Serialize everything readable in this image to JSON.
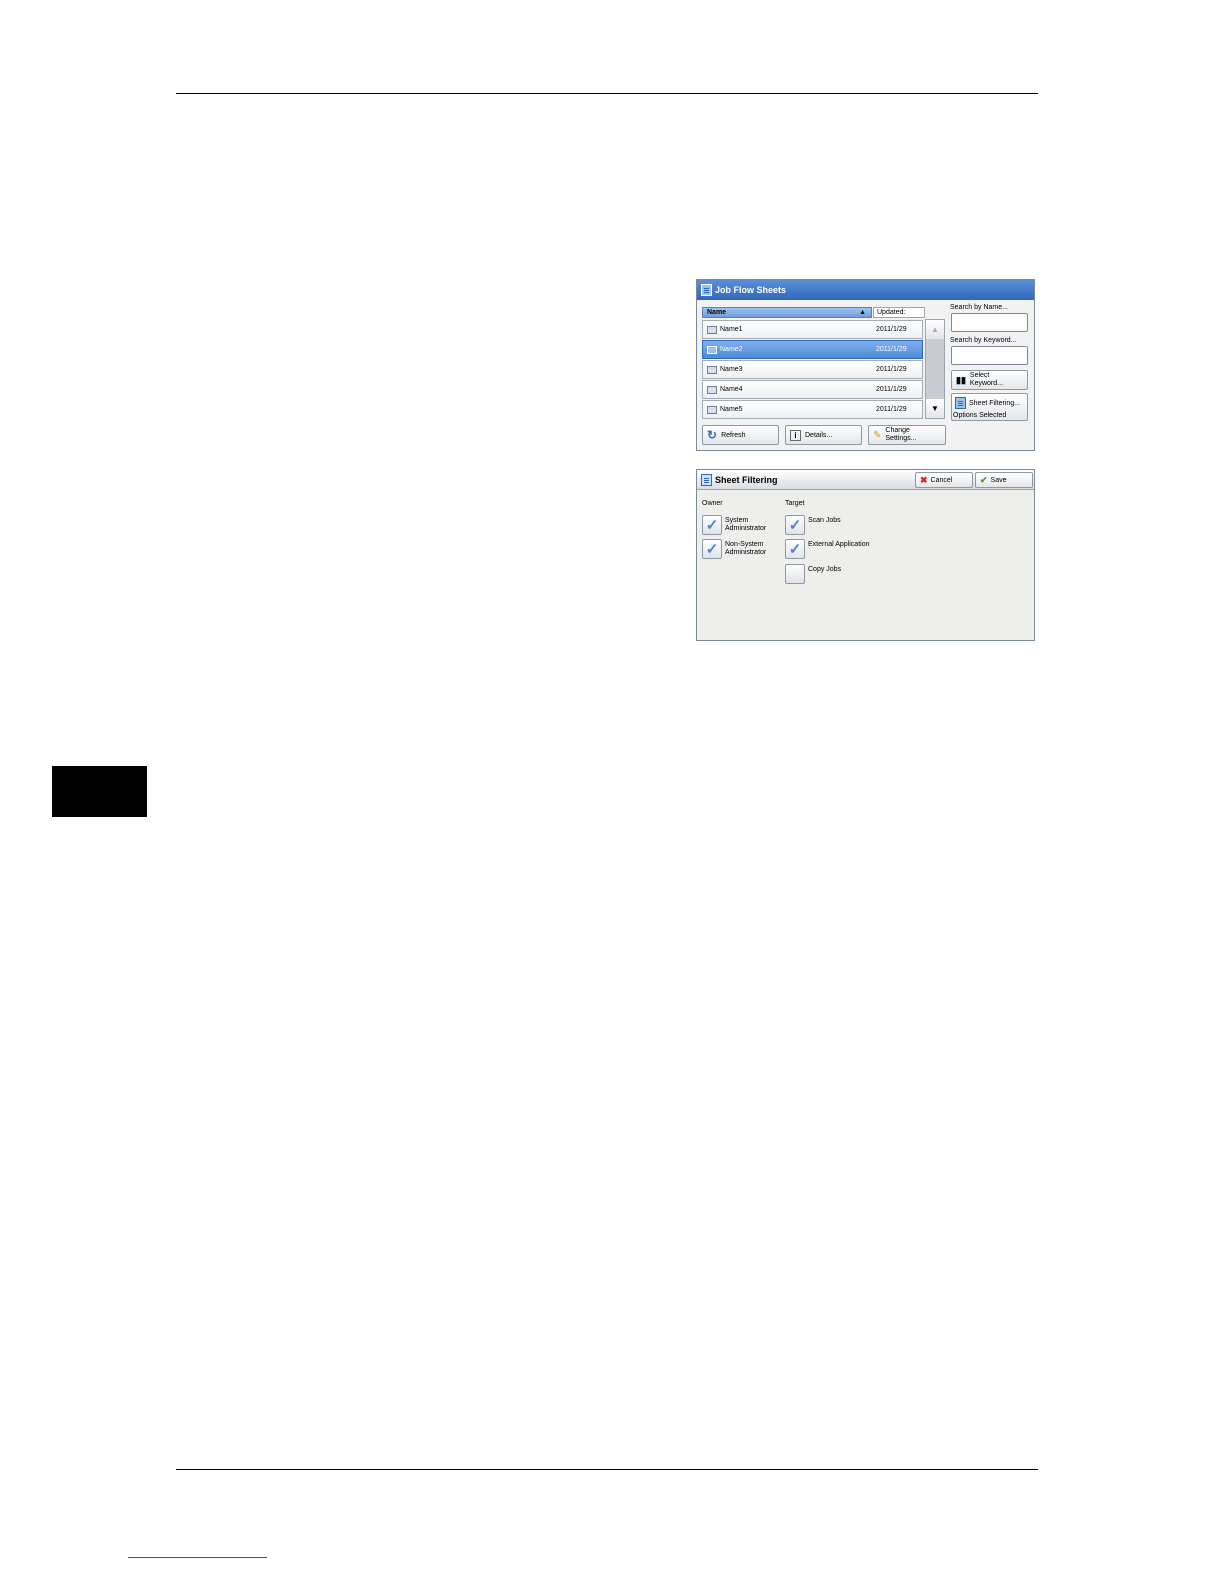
{
  "job_flow_sheets": {
    "title": "Job Flow Sheets",
    "columns": {
      "name": "Name",
      "updated": "Updated:"
    },
    "rows": [
      {
        "name": "Name1",
        "date": "2011/1/29",
        "selected": false
      },
      {
        "name": "Name2",
        "date": "2011/1/29",
        "selected": true
      },
      {
        "name": "Name3",
        "date": "2011/1/29",
        "selected": false
      },
      {
        "name": "Name4",
        "date": "2011/1/29",
        "selected": false
      },
      {
        "name": "Name5",
        "date": "2011/1/29",
        "selected": false
      }
    ],
    "search_by_name_label": "Search by Name...",
    "search_by_keyword_label": "Search by Keyword...",
    "select_keyword_label": [
      "Select",
      "Keyword..."
    ],
    "sheet_filtering_label": "Sheet Filtering...",
    "options_selected": "Options Selected",
    "refresh_label": "Refresh",
    "details_label": "Details...",
    "change_settings_label": [
      "Change",
      "Settings..."
    ]
  },
  "sheet_filtering": {
    "title": "Sheet Filtering",
    "cancel_label": "Cancel",
    "save_label": "Save",
    "owner_heading": "Owner",
    "target_heading": "Target",
    "owner_options": [
      {
        "label": [
          "System",
          "Administrator"
        ],
        "checked": true
      },
      {
        "label": [
          "Non-System",
          "Administrator"
        ],
        "checked": true
      }
    ],
    "target_options": [
      {
        "label": "Scan Jobs",
        "checked": true
      },
      {
        "label": "External Application",
        "checked": true
      },
      {
        "label": "Copy Jobs",
        "checked": false
      }
    ]
  }
}
